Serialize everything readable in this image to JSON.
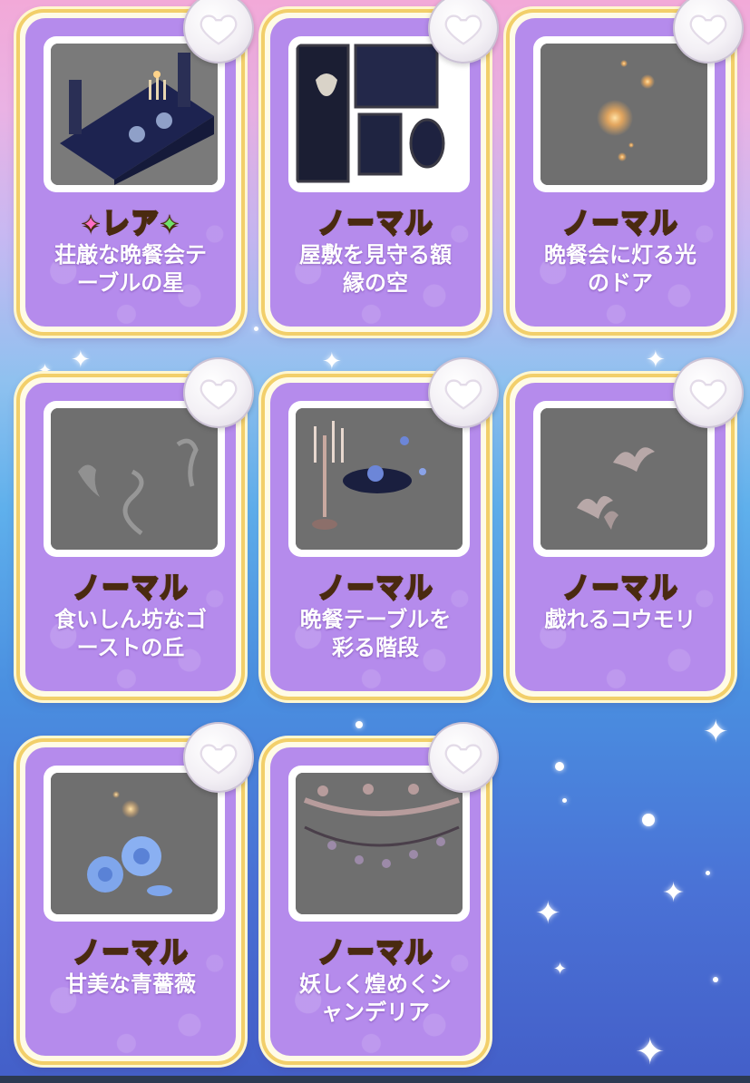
{
  "cards": [
    {
      "rarity": "レア",
      "rarity_type": "rare",
      "name_lines": [
        "荘厳な晩餐会テ",
        "ーブルの星"
      ],
      "thumb_icon": "dining-table-icon",
      "favorite": false
    },
    {
      "rarity": "ノーマル",
      "rarity_type": "normal",
      "name_lines": [
        "屋敷を見守る額",
        "縁の空"
      ],
      "thumb_icon": "picture-frames-icon",
      "favorite": false
    },
    {
      "rarity": "ノーマル",
      "rarity_type": "normal",
      "name_lines": [
        "晩餐会に灯る光",
        "のドア"
      ],
      "thumb_icon": "glowing-lights-icon",
      "favorite": false
    },
    {
      "rarity": "ノーマル",
      "rarity_type": "normal",
      "name_lines": [
        "食いしん坊なゴ",
        "ーストの丘"
      ],
      "thumb_icon": "ghost-smoke-icon",
      "favorite": false
    },
    {
      "rarity": "ノーマル",
      "rarity_type": "normal",
      "name_lines": [
        "晩餐テーブルを",
        "彩る階段"
      ],
      "thumb_icon": "candelabra-icon",
      "favorite": false
    },
    {
      "rarity": "ノーマル",
      "rarity_type": "normal",
      "name_lines": [
        "戯れるコウモリ",
        ""
      ],
      "thumb_icon": "bats-icon",
      "favorite": false
    },
    {
      "rarity": "ノーマル",
      "rarity_type": "normal",
      "name_lines": [
        "甘美な青薔薇",
        ""
      ],
      "thumb_icon": "blue-rose-icon",
      "favorite": false
    },
    {
      "rarity": "ノーマル",
      "rarity_type": "normal",
      "name_lines": [
        "妖しく煌めくシ",
        "ャンデリア"
      ],
      "thumb_icon": "chandelier-icon",
      "favorite": false
    }
  ],
  "colors": {
    "card_purple": "#b58bec",
    "card_border_gold": "#f2cf6a",
    "thumb_gray": "#6f6f6f",
    "rarity_text": "#ffe04a",
    "name_text": "#ffffff"
  }
}
